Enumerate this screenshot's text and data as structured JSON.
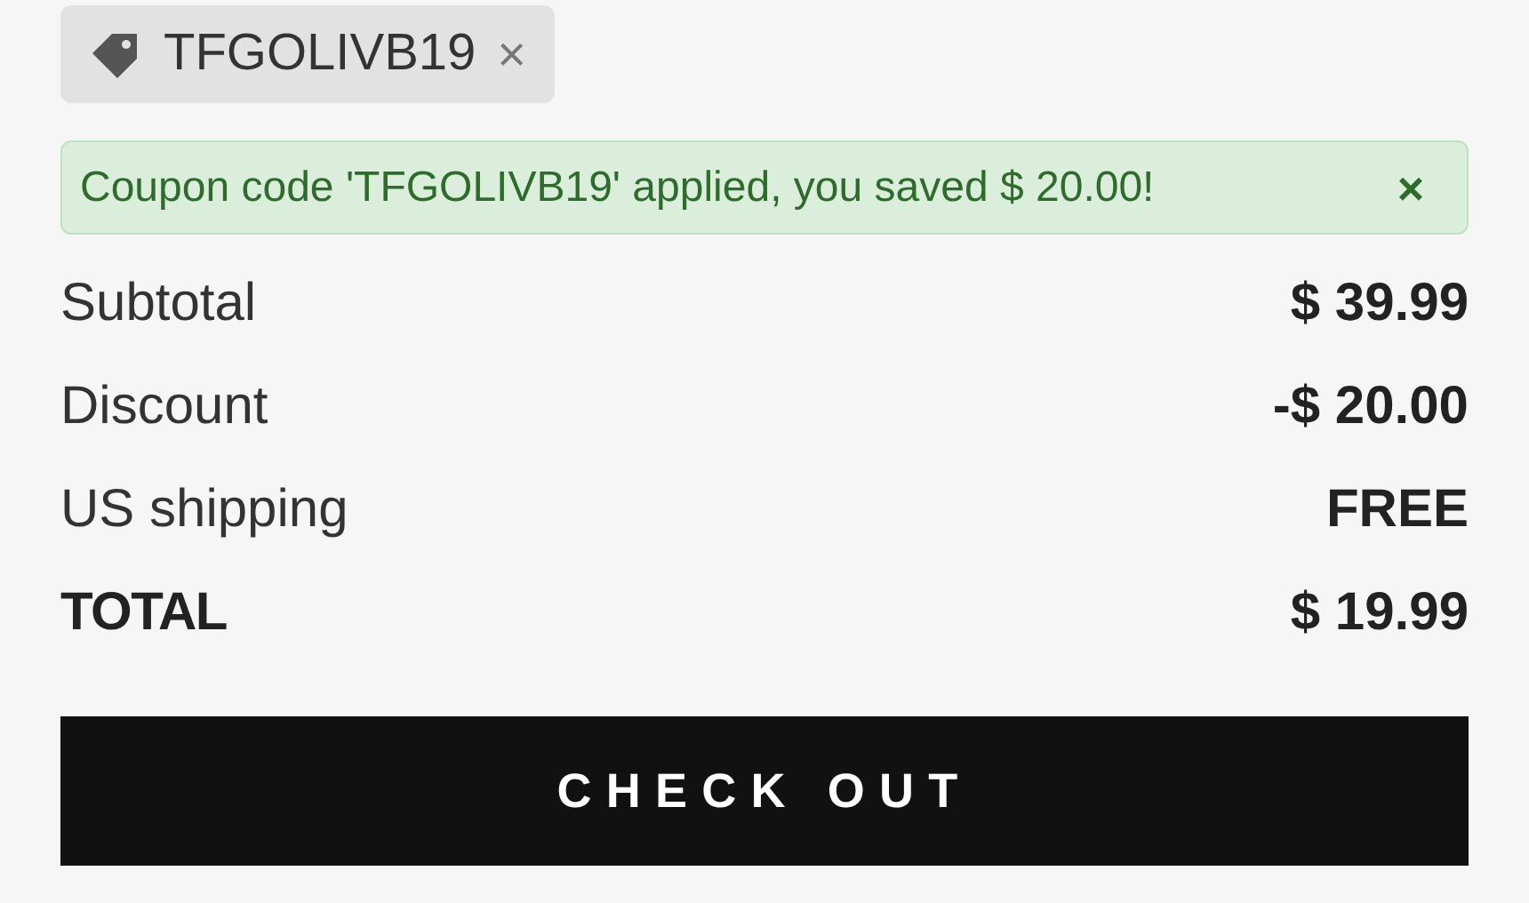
{
  "coupon": {
    "code": "TFGOLIVB19",
    "remove": "×"
  },
  "alert": {
    "message": "Coupon code 'TFGOLIVB19' applied, you saved $ 20.00!",
    "close": "×"
  },
  "summary": [
    {
      "label": "Subtotal",
      "value": "$ 39.99",
      "kind": "normal"
    },
    {
      "label": "Discount",
      "value": "-$ 20.00",
      "kind": "normal"
    },
    {
      "label": "US shipping",
      "value": "FREE",
      "kind": "normal"
    },
    {
      "label": "TOTAL",
      "value": "$ 19.99",
      "kind": "total"
    }
  ],
  "checkout_button": "CHECK OUT"
}
